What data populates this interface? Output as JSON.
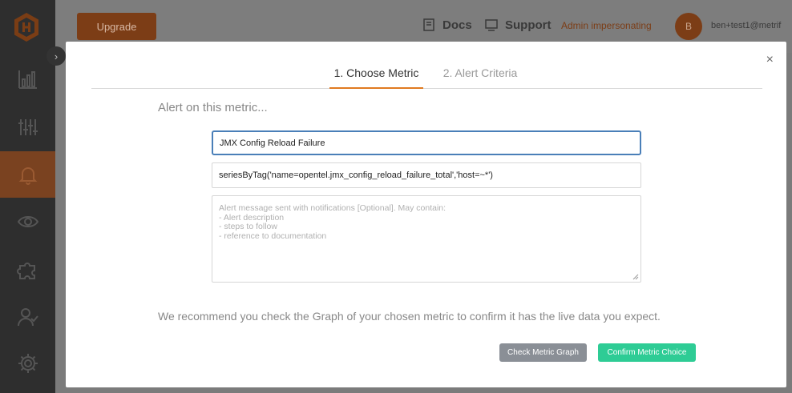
{
  "topbar": {
    "upgrade_label": "Upgrade",
    "docs_label": "Docs",
    "support_label": "Support",
    "impersonating_label": "Admin impersonating",
    "avatar_initial": "B",
    "user_email": "ben+test1@metrif"
  },
  "sidebar": {
    "items": [
      {
        "icon": "bar-chart-icon"
      },
      {
        "icon": "sliders-icon"
      },
      {
        "icon": "bell-icon",
        "active": true
      },
      {
        "icon": "eye-icon"
      },
      {
        "icon": "puzzle-icon"
      },
      {
        "icon": "users-icon"
      },
      {
        "icon": "gear-icon"
      }
    ]
  },
  "modal": {
    "close_label": "×",
    "tabs": [
      {
        "label": "1. Choose Metric",
        "active": true
      },
      {
        "label": "2. Alert Criteria",
        "active": false
      }
    ],
    "heading": "Alert on this metric...",
    "alert_name_value": "JMX Config Reload Failure",
    "query_value": "seriesByTag('name=opentel.jmx_config_reload_failure_total','host=~*')",
    "message_placeholder": "Alert message sent with notifications [Optional]. May contain:\n- Alert description\n- steps to follow\n- reference to documentation",
    "recommend_text": "We recommend you check the Graph of your chosen metric to confirm it has the live data you expect.",
    "check_button": "Check Metric Graph",
    "confirm_button": "Confirm Metric Choice"
  },
  "colors": {
    "accent": "#e07a20",
    "confirm": "#2ecc95",
    "focus": "#4a7fb8"
  }
}
